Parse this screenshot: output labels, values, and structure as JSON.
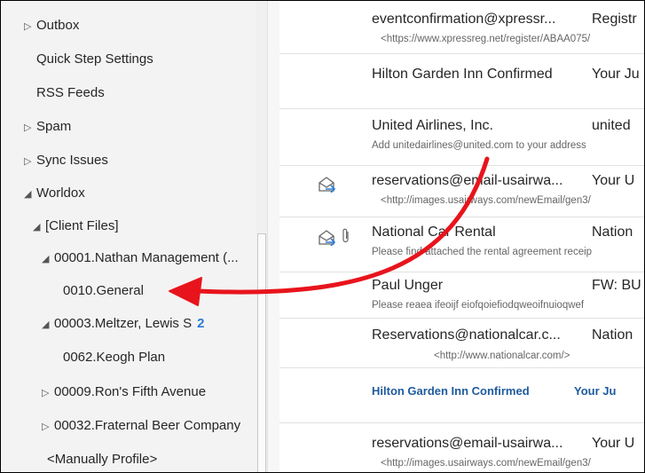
{
  "folders": [
    {
      "label": "Outbox",
      "expander": "▷"
    },
    {
      "label": "Quick Step Settings",
      "expander": ""
    },
    {
      "label": "RSS Feeds",
      "expander": ""
    },
    {
      "label": "Spam",
      "expander": "▷"
    },
    {
      "label": "Sync Issues",
      "expander": "▷"
    },
    {
      "label": "Worldox",
      "expander": "◢"
    },
    {
      "label": "[Client Files]",
      "expander": "◢"
    },
    {
      "label": "00001.Nathan Management (...",
      "expander": "◢"
    },
    {
      "label": "0010.General",
      "expander": ""
    },
    {
      "label": "00003.Meltzer, Lewis S",
      "expander": "◢",
      "count": "2"
    },
    {
      "label": "0062.Keogh Plan",
      "expander": ""
    },
    {
      "label": "00009.Ron's Fifth Avenue",
      "expander": "▷"
    },
    {
      "label": "00032.Fraternal Beer Company",
      "expander": "▷"
    },
    {
      "label": "<Manually Profile>",
      "expander": ""
    }
  ],
  "messages": [
    {
      "sender": "eventconfirmation@xpressr...",
      "subject": "Registr",
      "preview": "<https://www.xpressreg.net/register/ABAA075/"
    },
    {
      "sender": "Hilton Garden Inn Confirmed",
      "subject": "Your Ju",
      "preview": ""
    },
    {
      "sender": "United Airlines, Inc.",
      "subject": "united",
      "preview": "Add unitedairlines@united.com to your address"
    },
    {
      "sender": "reservations@email-usairwa...",
      "subject": "Your U",
      "preview": "<http://images.usairways.com/newEmail/gen3/"
    },
    {
      "sender": "National Car Rental",
      "subject": "Nation",
      "preview": "Please find attached the rental agreement receip"
    },
    {
      "sender": "Paul Unger",
      "subject": "FW: BU",
      "preview": "Please reaea ifeoijf eiofqoiefiodqweoifnuioqwef"
    },
    {
      "sender": "Reservations@nationalcar.c...",
      "subject": "Nation",
      "preview": "<http://www.nationalcar.com/>"
    },
    {
      "sender": "Hilton Garden Inn Confirmed",
      "subject": "Your Ju",
      "preview": ""
    },
    {
      "sender": "reservations@email-usairwa...",
      "subject": "Your U",
      "preview": "<http://images.usairways.com/newEmail/gen3/"
    }
  ],
  "colors": {
    "accent": "#2b7cd3",
    "annotation_arrow": "#e8141c",
    "unread": "#1e5a9c"
  }
}
